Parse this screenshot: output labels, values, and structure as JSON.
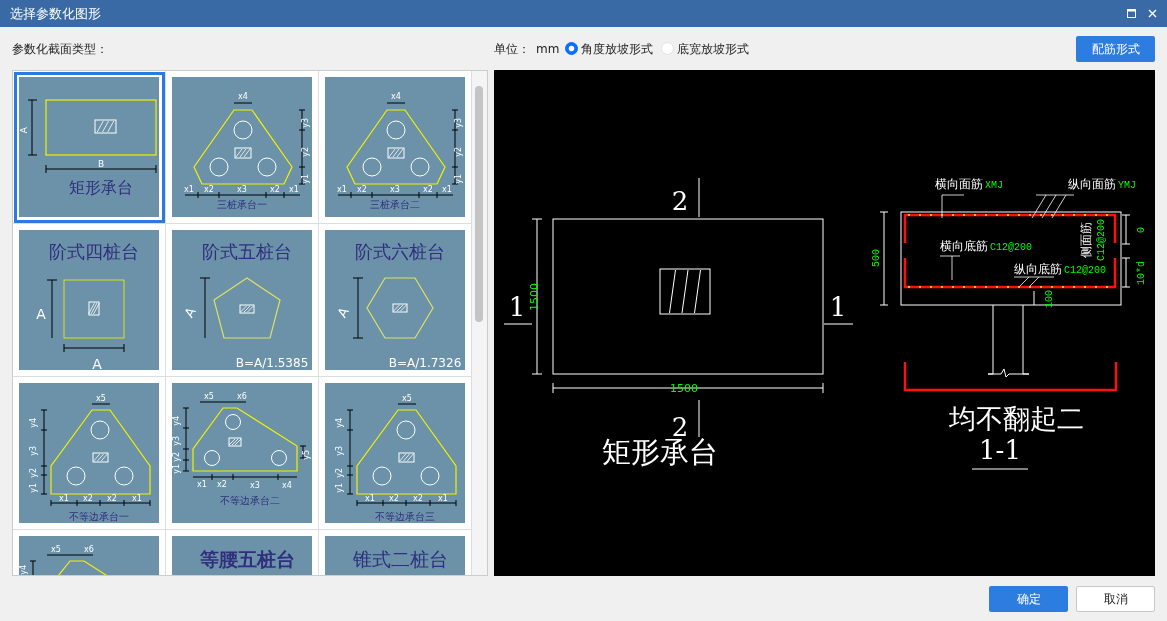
{
  "window": {
    "title": "选择参数化图形"
  },
  "section_types": {
    "label": "参数化截面类型：",
    "tiles": [
      {
        "kind": "rect",
        "selected": true,
        "caption": "矩形承台",
        "labels": [
          "A",
          "B"
        ]
      },
      {
        "kind": "tri",
        "selected": false,
        "caption": "三桩承台一",
        "labels": [
          "x4",
          "y3",
          "y2",
          "y1",
          "x1",
          "x2",
          "x3",
          "x2",
          "x1"
        ]
      },
      {
        "kind": "tri",
        "selected": false,
        "caption": "三桩承台二",
        "labels": [
          "x4",
          "y3",
          "y2",
          "y1",
          "x1",
          "x2",
          "x3",
          "x2",
          "x1"
        ]
      },
      {
        "kind": "step4",
        "selected": false,
        "title": "阶式四桩台",
        "labels": [
          "A",
          "A"
        ]
      },
      {
        "kind": "step5",
        "selected": false,
        "title": "阶式五桩台",
        "labels": [
          "A",
          "B=A/1.5385"
        ]
      },
      {
        "kind": "step6",
        "selected": false,
        "title": "阶式六桩台",
        "labels": [
          "A",
          "B=A/1.7326"
        ]
      },
      {
        "kind": "uneq",
        "selected": false,
        "caption": "不等边承台一",
        "labels": [
          "x5",
          "y4",
          "y3",
          "y2",
          "y1",
          "x1",
          "x2",
          "x2",
          "x1"
        ]
      },
      {
        "kind": "uneq2",
        "selected": false,
        "caption": "不等边承台二",
        "labels": [
          "x5",
          "x6",
          "y4",
          "y3",
          "y2",
          "y1",
          "y5",
          "x1",
          "x2",
          "x3",
          "x4"
        ]
      },
      {
        "kind": "uneq",
        "selected": false,
        "caption": "不等边承台三",
        "labels": [
          "x5",
          "y4",
          "y3",
          "y2",
          "y1",
          "x1",
          "x2",
          "x2",
          "x1"
        ]
      },
      {
        "kind": "uneq2-top",
        "selected": false,
        "labels": [
          "x5",
          "x6",
          "y4"
        ]
      },
      {
        "kind": "blank-bold",
        "selected": false,
        "title": "等腰五桩台"
      },
      {
        "kind": "blank",
        "selected": false,
        "title": "锥式二桩台"
      }
    ]
  },
  "options": {
    "unit_label": "单位：",
    "unit": "mm",
    "slope_modes": [
      {
        "label": "角度放坡形式",
        "selected": true
      },
      {
        "label": "底宽放坡形式",
        "selected": false
      }
    ],
    "rebar_button": "配筋形式"
  },
  "preview": {
    "plan": {
      "section_marks": [
        "2",
        "2",
        "1",
        "1"
      ],
      "height_dim": "1500",
      "width_dim": "1500",
      "caption": "矩形承台"
    },
    "section": {
      "callouts": [
        {
          "name": "横向面筋",
          "spec": "XMJ"
        },
        {
          "name": "纵向面筋",
          "spec": "YMJ"
        },
        {
          "name": "横向底筋",
          "spec": "C12@200"
        },
        {
          "name": "纵向底筋",
          "spec": "C12@200"
        },
        {
          "name": "侧面筋",
          "spec": "C12@200"
        }
      ],
      "dims": [
        "500",
        "0",
        "10*d",
        "100"
      ],
      "caption": "均不翻起二",
      "label": "1-1"
    }
  },
  "buttons": [
    "确定",
    "取消"
  ]
}
